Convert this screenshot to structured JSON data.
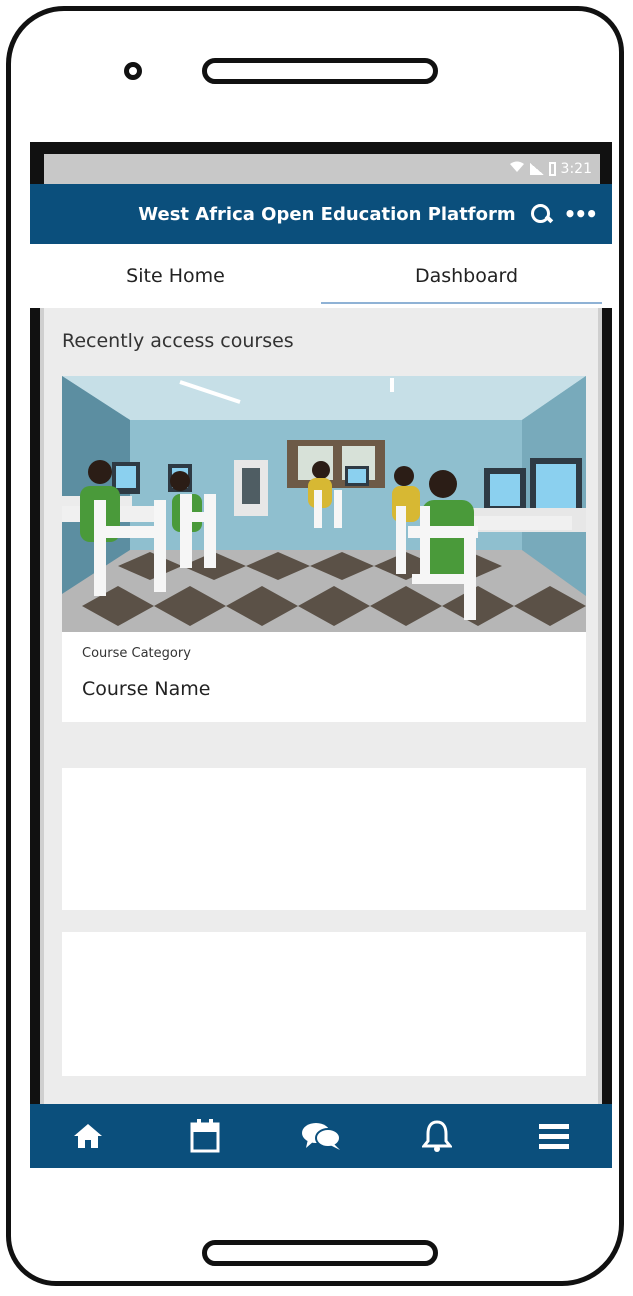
{
  "status_bar": {
    "time": "3:21"
  },
  "app_bar": {
    "title": "West Africa Open Education Platform",
    "search_icon": "search-icon",
    "more_icon": "more-icon"
  },
  "tabs": [
    {
      "label": "Site Home",
      "active": false
    },
    {
      "label": "Dashboard",
      "active": true
    }
  ],
  "main": {
    "section_title": "Recently access courses",
    "courses": [
      {
        "category": "Course Category",
        "name": "Course Name"
      }
    ]
  },
  "bottom_nav": [
    {
      "icon": "home-icon"
    },
    {
      "icon": "calendar-icon"
    },
    {
      "icon": "chat-icon"
    },
    {
      "icon": "bell-icon"
    },
    {
      "icon": "menu-icon"
    }
  ],
  "colors": {
    "app_bar": "#0b4f7c",
    "tab_indicator": "#8fb2d5",
    "content_background": "#ececec"
  }
}
